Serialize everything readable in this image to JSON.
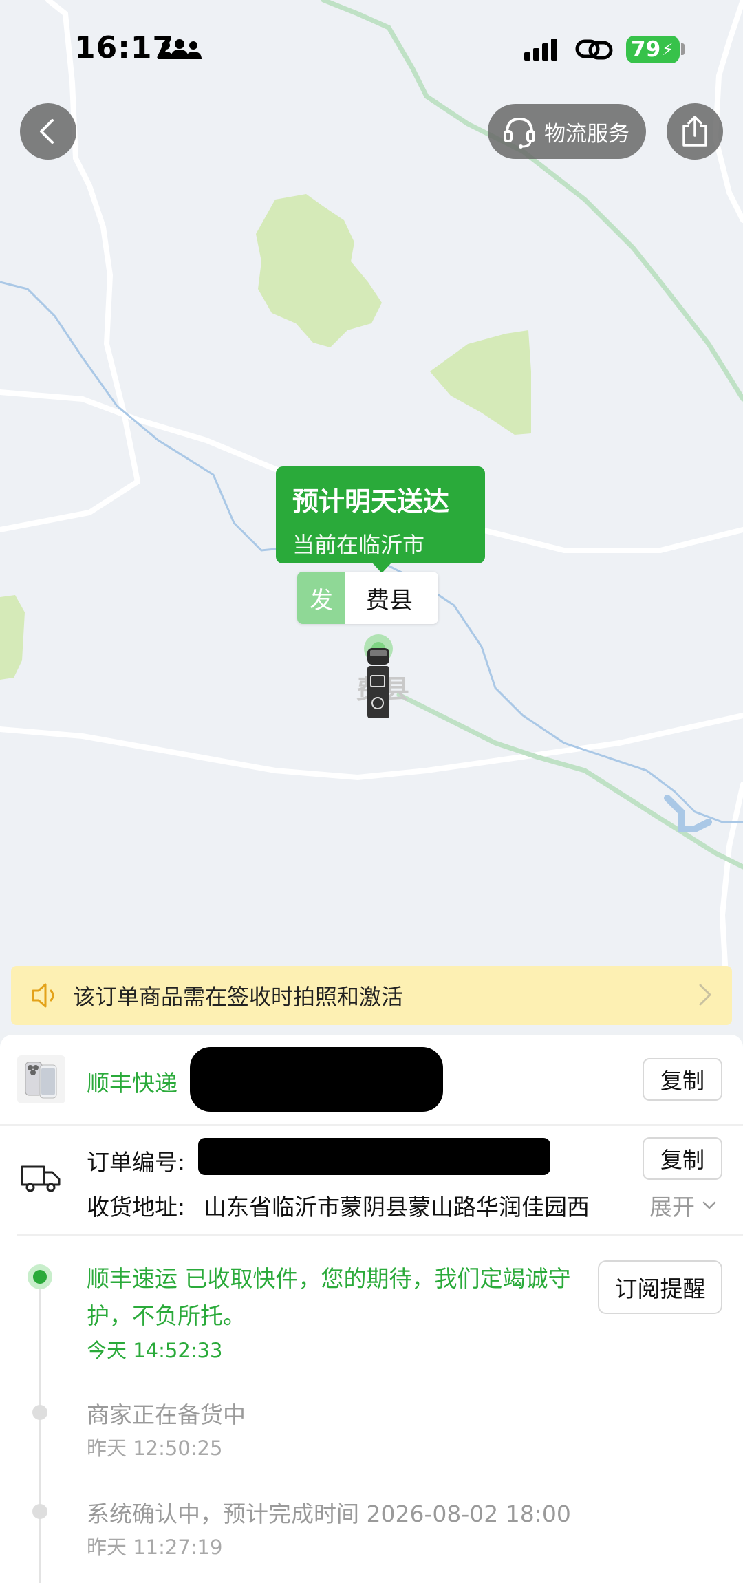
{
  "status_bar": {
    "time": "16:17",
    "battery": "79"
  },
  "header": {
    "logistics_service_label": "物流服务"
  },
  "map": {
    "eta_title": "预计明天送达",
    "eta_location": "当前在临沂市",
    "origin_tag_type": "发",
    "origin_tag_name": "费县",
    "town_label": "费县"
  },
  "notice": {
    "text": "该订单商品需在签收时拍照和激活"
  },
  "shipment": {
    "carrier": "顺丰快递",
    "tracking_number": "",
    "copy_label": "复制",
    "order_label": "订单编号:",
    "order_number": "",
    "address_label": "收货地址:",
    "address_value": "山东省临沂市蒙阴县蒙山路华润佳园西",
    "expand_label": "展开"
  },
  "timeline": {
    "subscribe_label": "订阅提醒",
    "events": [
      {
        "text": "顺丰速运 已收取快件，您的期待，我们定竭诚守护，不负所托。",
        "time": "今天 14:52:33"
      },
      {
        "text": "商家正在备货中",
        "time": "昨天 12:50:25"
      },
      {
        "text": "系统确认中，预计完成时间 2026-08-02 18:00",
        "time": "昨天 11:27:19"
      }
    ]
  },
  "colors": {
    "accent": "#2aaa3a",
    "notice_bg": "#fdf0b3",
    "map_bg": "#eef1f5",
    "park_green": "#d5eab8"
  }
}
